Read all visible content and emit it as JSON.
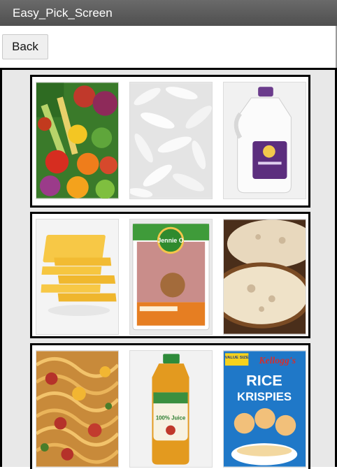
{
  "window": {
    "title": "Easy_Pick_Screen"
  },
  "toolbar": {
    "back_label": "Back"
  },
  "groups": [
    {
      "items": [
        {
          "icon": "vegetables-image"
        },
        {
          "icon": "rice-image"
        },
        {
          "icon": "milk-jug-image"
        }
      ]
    },
    {
      "items": [
        {
          "icon": "cheese-slices-image"
        },
        {
          "icon": "ground-turkey-image",
          "brand": "Jennie O"
        },
        {
          "icon": "bread-image"
        }
      ]
    },
    {
      "items": [
        {
          "icon": "spaghetti-image"
        },
        {
          "icon": "apple-juice-image",
          "label": "100% Juice"
        },
        {
          "icon": "rice-krispies-image",
          "badge": "VALUE SIZE",
          "brand": "Kellogg's",
          "line1": "RICE",
          "line2": "KRISPIES"
        }
      ]
    }
  ]
}
